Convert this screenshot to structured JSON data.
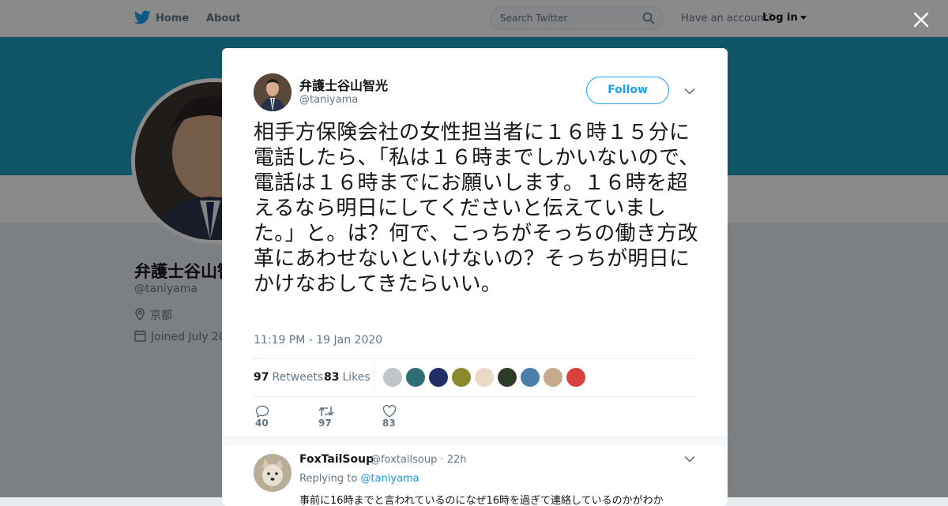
{
  "topbar": {
    "home_label": "Home",
    "about_label": "About",
    "search_placeholder": "Search Twitter",
    "have_account": "Have an account?",
    "login_label": "Log in"
  },
  "profile": {
    "name": "弁護士谷山智光",
    "handle": "@taniyama",
    "location": "京都",
    "joined": "Joined July 20"
  },
  "tweet": {
    "author_name": "弁護士谷山智光",
    "author_handle": "@taniyama",
    "follow_label": "Follow",
    "text": "相手方保険会社の女性担当者に１６時１５分に電話したら、「私は１６時までしかいないので、電話は１６時までにお願いします。１６時を超えるなら明日にしてくださいと伝えていました。」と。は？何で、こっちがそっちの働き方改革にあわせないといけないの？そっちが明日にかけなおしてきたらいい。",
    "timestamp": "11:19 PM - 19 Jan 2020",
    "retweets_count": "97",
    "retweets_label": "Retweets",
    "likes_count": "83",
    "likes_label": "Likes",
    "reply_count": "40",
    "retweet_action_count": "97",
    "like_action_count": "83"
  },
  "likers": [
    {
      "name": "liker-1",
      "color": "#bfc5c9"
    },
    {
      "name": "liker-2",
      "color": "#2f6f73"
    },
    {
      "name": "liker-3",
      "color": "#1f2f66"
    },
    {
      "name": "liker-4",
      "color": "#8a8a2c"
    },
    {
      "name": "liker-5",
      "color": "#e9d9c6"
    },
    {
      "name": "liker-6",
      "color": "#2e3b2b"
    },
    {
      "name": "liker-7",
      "color": "#4b7fa8"
    },
    {
      "name": "liker-8",
      "color": "#c7a98d"
    },
    {
      "name": "liker-9",
      "color": "#d94040"
    }
  ],
  "reply": {
    "author_name": "FoxTailSoup",
    "author_handle": "@foxtailsoup",
    "time": "22h",
    "replying_to_label": "Replying to",
    "replying_to_handle": "@taniyama",
    "text": "事前に16時までと言われているのになぜ16時を過ぎて連絡しているのかがわか"
  },
  "colors": {
    "brand_blue": "#1da1f2",
    "banner": "#1f9cc1",
    "text_primary": "#14171a",
    "text_secondary": "#657786"
  }
}
